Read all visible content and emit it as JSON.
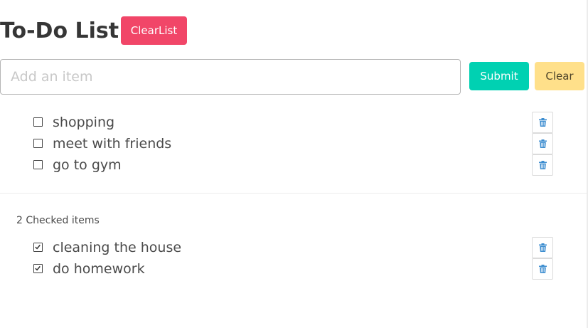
{
  "header": {
    "title": "To-Do List",
    "clear_list_label": "ClearList"
  },
  "form": {
    "input_placeholder": "Add an item",
    "input_value": "",
    "submit_label": "Submit",
    "clear_label": "Clear"
  },
  "unchecked_items": [
    {
      "label": "shopping",
      "checked": false,
      "delete_icon": "trash-icon"
    },
    {
      "label": "meet with friends",
      "checked": false,
      "delete_icon": "trash-icon"
    },
    {
      "label": "go to gym",
      "checked": false,
      "delete_icon": "trash-icon"
    }
  ],
  "checked_section": {
    "count_label": "2 Checked items"
  },
  "checked_items": [
    {
      "label": "cleaning the house",
      "checked": true,
      "delete_icon": "trash-icon"
    },
    {
      "label": "do homework",
      "checked": true,
      "delete_icon": "trash-icon"
    }
  ],
  "colors": {
    "clear_list_button": "#f14668",
    "submit_button": "#00d1b2",
    "clear_button": "#ffe08a",
    "trash_icon": "#3e8ed0"
  }
}
